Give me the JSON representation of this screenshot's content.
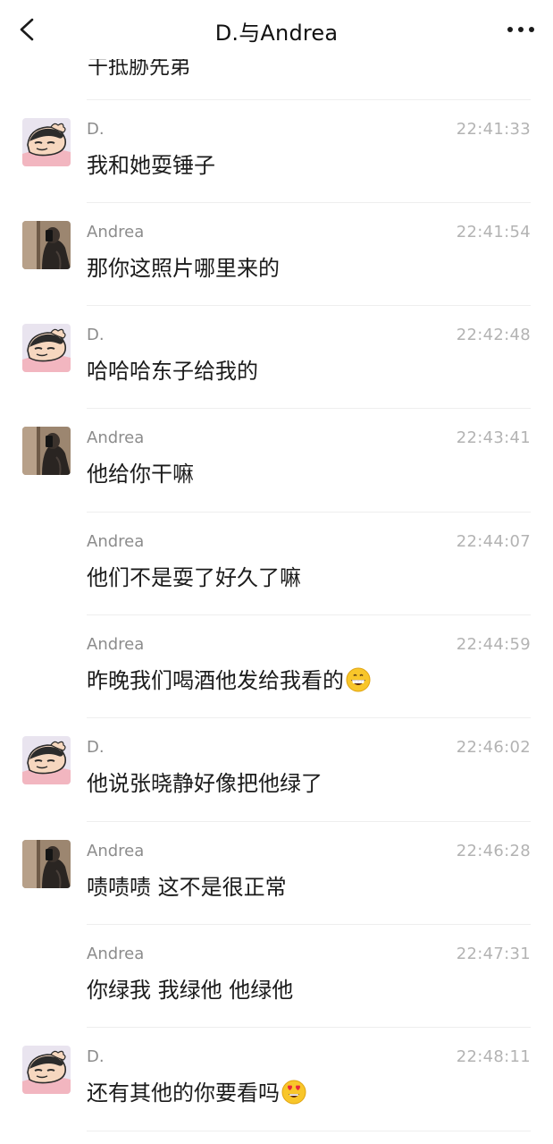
{
  "header": {
    "title": "D.与Andrea",
    "back_icon": "chevron-left-icon",
    "more_icon": "more-dots-icon"
  },
  "partial_message": "干抵胁先弟",
  "colors": {
    "sender": "#8c8c8c",
    "time": "#b3b3b3",
    "text": "#1b1b1b",
    "divider": "#eeeeee"
  },
  "messages": [
    {
      "sender": "D.",
      "avatar": "cartoon-avatar",
      "time": "22:41:33",
      "text": "我和她耍锤子"
    },
    {
      "sender": "Andrea",
      "avatar": "mirror-selfie-avatar",
      "time": "22:41:54",
      "text": "那你这照片哪里来的"
    },
    {
      "sender": "D.",
      "avatar": "cartoon-avatar",
      "time": "22:42:48",
      "text": "哈哈哈东子给我的"
    },
    {
      "sender": "Andrea",
      "avatar": "mirror-selfie-avatar",
      "time": "22:43:41",
      "text": "他给你干嘛"
    },
    {
      "sender": "Andrea",
      "avatar": "",
      "time": "22:44:07",
      "text": "他们不是耍了好久了嘛"
    },
    {
      "sender": "Andrea",
      "avatar": "",
      "time": "22:44:59",
      "text": "昨晚我们喝酒他发给我看的",
      "emoji": "grinning-face-icon"
    },
    {
      "sender": "D.",
      "avatar": "cartoon-avatar",
      "time": "22:46:02",
      "text": "他说张晓静好像把他绿了"
    },
    {
      "sender": "Andrea",
      "avatar": "mirror-selfie-avatar",
      "time": "22:46:28",
      "text": "啧啧啧 这不是很正常"
    },
    {
      "sender": "Andrea",
      "avatar": "",
      "time": "22:47:31",
      "text": "你绿我 我绿他 他绿他"
    },
    {
      "sender": "D.",
      "avatar": "cartoon-avatar",
      "time": "22:48:11",
      "text": "还有其他的你要看吗",
      "emoji": "heart-eyes-face-icon"
    }
  ]
}
